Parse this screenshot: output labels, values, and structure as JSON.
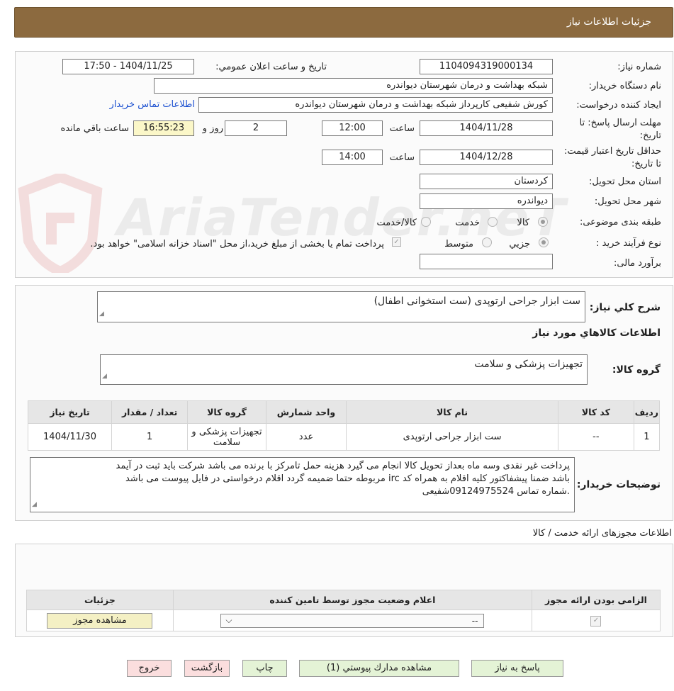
{
  "header": {
    "title": "جزئیات اطلاعات نیاز"
  },
  "details": {
    "need_number_label": "شماره نیاز:",
    "need_number": "1104094319000134",
    "announce_label": "تاریخ و ساعت اعلان عمومي:",
    "announce_value": "1404/11/25 - 17:50",
    "buyer_org_label": "نام دستگاه خریدار:",
    "buyer_org": "شبکه بهداشت و درمان شهرستان دیواندره",
    "creator_label": "ایجاد کننده درخواست:",
    "creator": "کورش شفیعی کارپرداز شبکه بهداشت و درمان شهرستان دیواندره",
    "contact_link": "اطلاعات تماس خریدار",
    "deadline_label": "مهلت ارسال پاسخ: تا تاریخ:",
    "deadline_date": "1404/11/28",
    "time_label": "ساعت",
    "deadline_time": "12:00",
    "days_count": "2",
    "days_label": "روز و",
    "remaining_time": "16:55:23",
    "remaining_label": "ساعت باقي مانده",
    "validity_label": "حداقل تاریخ اعتبار قیمت: تا تاریخ:",
    "validity_date": "1404/12/28",
    "validity_time": "14:00",
    "province_label": "استان محل تحویل:",
    "province": "کردستان",
    "city_label": "شهر محل تحویل:",
    "city": "دیواندره",
    "category_label": "طبقه بندی موضوعی:",
    "category_options": [
      "کالا",
      "خدمت",
      "کالا/خدمت"
    ],
    "category_selected": "کالا",
    "process_label": "نوع فرآیند خرید :",
    "process_options": [
      "جزیي",
      "متوسط"
    ],
    "process_selected": "جزیي",
    "payment_note": "پرداخت تمام یا بخشی از مبلغ خرید،از محل \"اسناد خزانه اسلامی\" خواهد بود.",
    "estimate_label": "برآورد مالی:",
    "estimate_value": ""
  },
  "summary": {
    "label": "شرح کلي نیاز:",
    "value": "ست ابزار جراحی ارتوپدی (ست استخوانی اطفال)",
    "goods_info_title": "اطلاعات کالاهاي مورد نیاز",
    "goods_group_label": "گروه کالا:",
    "goods_group_value": "تجهیزات پزشکی و سلامت"
  },
  "goods_table": {
    "headers": [
      "ردیف",
      "کد کالا",
      "نام کالا",
      "واحد شمارش",
      "گروه کالا",
      "تعداد / مقدار",
      "تاریخ نیاز"
    ],
    "rows": [
      [
        "1",
        "--",
        "ست ابزار جراحی ارتوپدی",
        "عدد",
        "تجهیزات پزشکی و سلامت",
        "1",
        "1404/11/30"
      ]
    ]
  },
  "buyer_notes": {
    "label": "توضیحات خریدار:",
    "lines": [
      "پرداخت غیر نقدی وسه  ماه  بعداز تحویل کالا  انجام می گیرد هزینه حمل تامرکز با برنده می باشد شرکت باید ثبت در آیمد",
      "باشد ضمنا پیشفاکتور کلیه اقلام به همراه کد irc مربوطه حتما ضمیمه گردد اقلام درخواستی در فایل پیوست می باشد",
      ".شماره تماس 09124975524شفیعی"
    ]
  },
  "licenses": {
    "section_title": "اطلاعات مجوزهای ارائه خدمت / کالا",
    "headers": [
      "الزامی بودن ارائه مجوز",
      "اعلام وضعیت مجوز توسط تامین کننده",
      "جزئیات"
    ],
    "status_selected": "--",
    "view_button": "مشاهده مجوز"
  },
  "actions": {
    "reply": "پاسخ به نیاز",
    "attachments": "مشاهده مدارك پیوستي (1)",
    "print": "چاپ",
    "back": "بازگشت",
    "exit": "خروج"
  },
  "watermark": {
    "text": "AriaTender.neT",
    "icon": "shield-logo-icon"
  },
  "colors": {
    "header_bg": "#8c6a3f",
    "highlight": "#fbf7c8",
    "link": "#1a4fd0",
    "green_btn": "#e4f3d6",
    "pink_btn": "#fbdede",
    "yellow_btn": "#f4f0c4"
  }
}
